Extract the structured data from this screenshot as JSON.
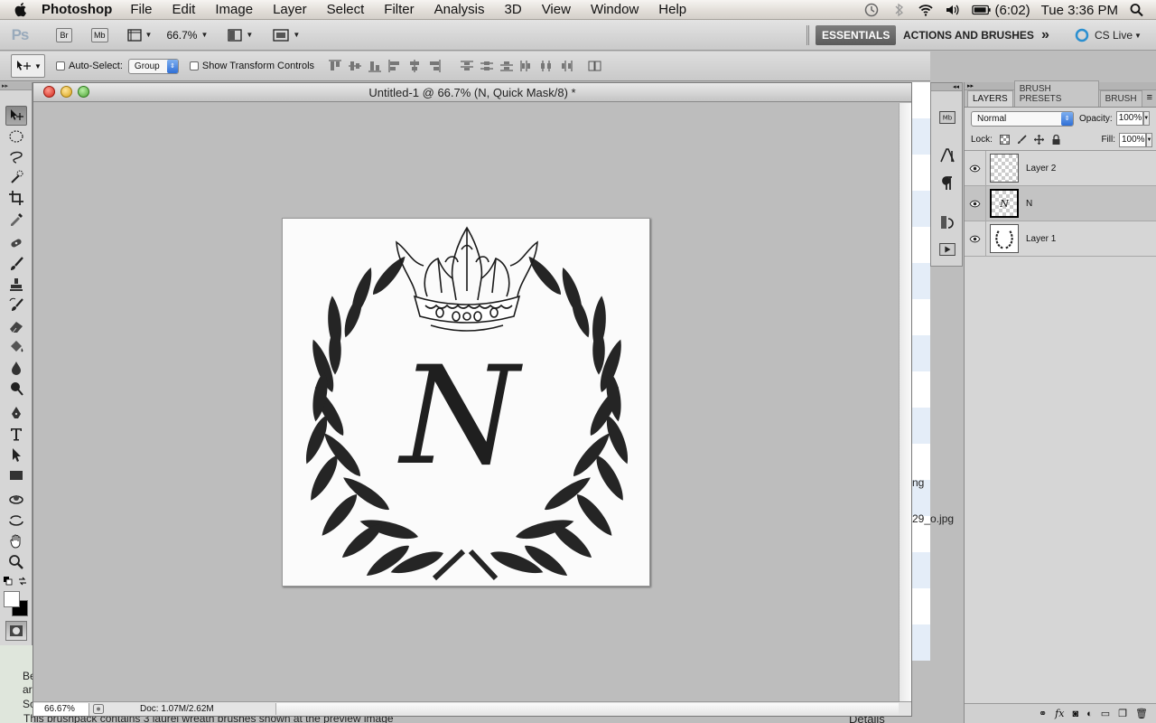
{
  "menubar": {
    "app_name": "Photoshop",
    "menus": [
      "File",
      "Edit",
      "Image",
      "Layer",
      "Select",
      "Filter",
      "Analysis",
      "3D",
      "View",
      "Window",
      "Help"
    ],
    "battery": "(6:02)",
    "clock": "Tue 3:36 PM"
  },
  "appbar": {
    "logo": "Ps",
    "bridge": "Br",
    "minibridge": "Mb",
    "zoom": "66.7%",
    "workspace_active": "ESSENTIALS",
    "workspace_other": "ACTIONS AND BRUSHES",
    "overflow": "»",
    "cs_live": "CS Live"
  },
  "options": {
    "auto_select_label": "Auto-Select:",
    "auto_select_target": "Group",
    "transform_label": "Show Transform Controls"
  },
  "document": {
    "title": "Untitled-1 @ 66.7% (N, Quick Mask/8) *",
    "letter": "N",
    "status_zoom": "66.67%",
    "status_doc": "Doc: 1.07M/2.62M"
  },
  "layers_panel": {
    "tabs": [
      "LAYERS",
      "BRUSH PRESETS",
      "BRUSH"
    ],
    "blend_mode": "Normal",
    "opacity_label": "Opacity:",
    "opacity": "100%",
    "lock_label": "Lock:",
    "fill_label": "Fill:",
    "fill": "100%",
    "layers": [
      {
        "name": "Layer 2",
        "selected": false
      },
      {
        "name": "N",
        "selected": true
      },
      {
        "name": "Layer 1",
        "selected": false
      }
    ]
  },
  "background": {
    "text_ng": "ng",
    "text_file": "29_o.jpg",
    "text_be": "Be",
    "text_ar": "ar",
    "text_sc": "Sc",
    "text_brushpack": "This brushpack contains 3 laurel wreath brushes shown at the preview image",
    "text_details": "Details"
  }
}
